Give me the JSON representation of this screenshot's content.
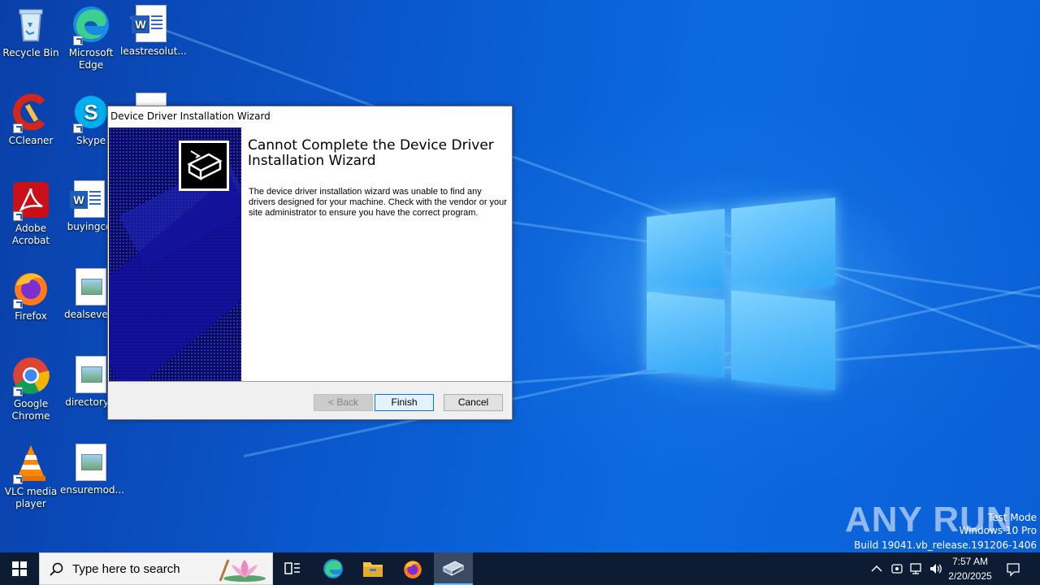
{
  "desktop": {
    "icons": [
      {
        "id": "recycle",
        "label": "Recycle Bin"
      },
      {
        "id": "edge",
        "label": "Microsoft Edge"
      },
      {
        "id": "leastres",
        "label": "leastresolut..."
      },
      {
        "id": "ccleaner",
        "label": "CCleaner"
      },
      {
        "id": "skype",
        "label": "Skype"
      },
      {
        "id": "acrobat",
        "label": "Adobe Acrobat"
      },
      {
        "id": "buying",
        "label": "buyingco"
      },
      {
        "id": "firefox",
        "label": "Firefox"
      },
      {
        "id": "dealsevera",
        "label": "dealsevera"
      },
      {
        "id": "chrome",
        "label": "Google Chrome"
      },
      {
        "id": "directory",
        "label": "directoryw"
      },
      {
        "id": "vlc",
        "label": "VLC media player"
      },
      {
        "id": "ensuremod",
        "label": "ensuremod..."
      }
    ],
    "watermark": {
      "test_mode": "Test Mode",
      "edition": "Windows 10 Pro",
      "build": "Build 19041.vb_release.191206-1406",
      "brand": "ANY RUN"
    }
  },
  "dialog": {
    "title": "Device Driver Installation Wizard",
    "heading": "Cannot Complete the Device Driver Installation Wizard",
    "message": "The device driver installation wizard was unable to find any drivers designed for your machine.  Check with the vendor or your site administrator to ensure you have the correct program.",
    "buttons": {
      "back": "< Back",
      "finish": "Finish",
      "cancel": "Cancel"
    }
  },
  "taskbar": {
    "search_placeholder": "Type here to search",
    "time": "7:57 AM",
    "date": "2/20/2025"
  }
}
